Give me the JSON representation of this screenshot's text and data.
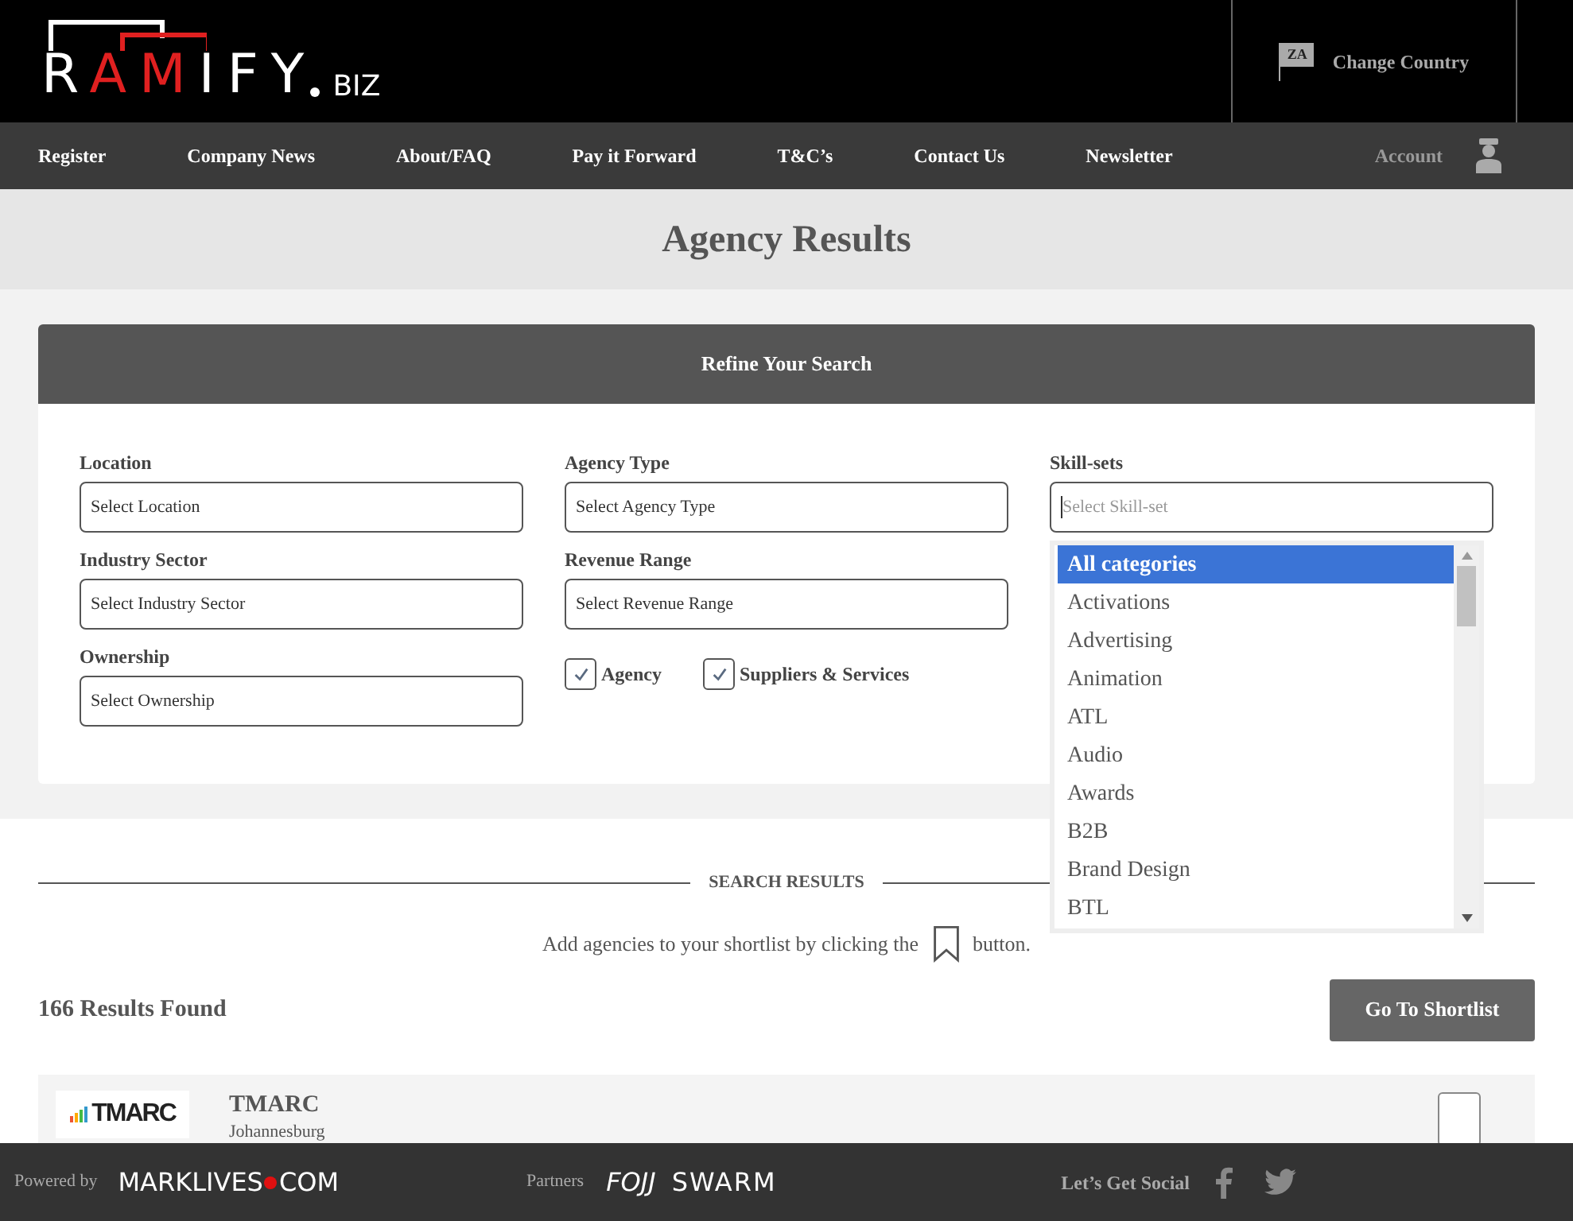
{
  "logo": {
    "parts": [
      {
        "text": "R",
        "accent": false
      },
      {
        "text": "AM",
        "accent": true
      },
      {
        "text": "IFY",
        "accent": false
      }
    ],
    "suffix": "BIZ"
  },
  "country": {
    "code": "ZA",
    "label": "Change Country"
  },
  "nav": {
    "items": [
      "Register",
      "Company News",
      "About/FAQ",
      "Pay it Forward",
      "T&C’s",
      "Contact Us",
      "Newsletter"
    ],
    "account": "Account"
  },
  "page_title": "Agency Results",
  "refine": {
    "title": "Refine Your Search",
    "fields": [
      {
        "label": "Location",
        "placeholder": "Select Location"
      },
      {
        "label": "Agency Type",
        "placeholder": "Select Agency Type"
      },
      {
        "label": "Skill-sets",
        "placeholder": "Select Skill-set"
      },
      {
        "label": "Industry Sector",
        "placeholder": "Select Industry Sector"
      },
      {
        "label": "Revenue Range",
        "placeholder": "Select Revenue Range"
      },
      {
        "label": "Ownership",
        "placeholder": "Select Ownership"
      }
    ],
    "checkboxes": [
      {
        "label": "Agency",
        "checked": true
      },
      {
        "label": "Suppliers & Services",
        "checked": true
      }
    ],
    "skill_options": [
      {
        "label": "All categories",
        "selected": true
      },
      {
        "label": "Activations",
        "selected": false
      },
      {
        "label": "Advertising",
        "selected": false
      },
      {
        "label": "Animation",
        "selected": false
      },
      {
        "label": "ATL",
        "selected": false
      },
      {
        "label": "Audio",
        "selected": false
      },
      {
        "label": "Awards",
        "selected": false
      },
      {
        "label": "B2B",
        "selected": false
      },
      {
        "label": "Brand Design",
        "selected": false
      },
      {
        "label": "BTL",
        "selected": false
      }
    ]
  },
  "results": {
    "heading": "SEARCH RESULTS",
    "hint_before": "Add agencies to your shortlist by clicking the",
    "hint_after": "button.",
    "count": "166 Results Found",
    "shortlist_button": "Go To Shortlist",
    "items": [
      {
        "logo": "TMARC",
        "name": "TMARC",
        "location": "Johannesburg"
      }
    ]
  },
  "footer": {
    "powered_by": "Powered by",
    "brand": [
      "MARKLIVES",
      "COM"
    ],
    "partners_label": "Partners",
    "partners": [
      "FOJJ",
      "SWARM"
    ],
    "social_label": "Let’s Get Social"
  }
}
